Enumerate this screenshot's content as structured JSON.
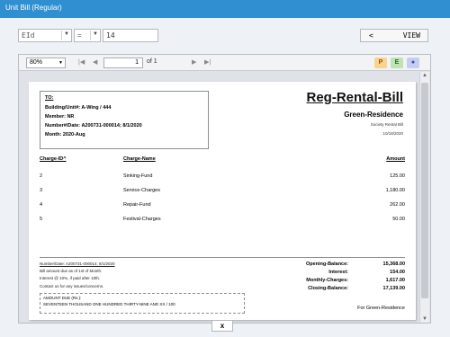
{
  "window": {
    "title": "Unit Bill (Regular)"
  },
  "filter": {
    "field_value": "EId",
    "operator_value": "=",
    "search_value": "14",
    "view_button_left": "<",
    "view_button_label": "VIEW"
  },
  "report_toolbar": {
    "zoom": "80%",
    "first": "|◀",
    "prev": "◀",
    "page": "1",
    "of_pages": "of 1",
    "next": "▶",
    "last": "▶|",
    "export_pdf": "P",
    "export_excel": "E",
    "export_other": "●"
  },
  "bill": {
    "to_label": "TO:",
    "building_unit": "Building/Unit#: A-Wing / 444",
    "member": "Member: NR",
    "number_date": "Number#/Date: A200731-000014; 8/1/2020",
    "month": "Month: 2020-Aug",
    "title": "Reg-Rental-Bill",
    "org": "Green-Residence",
    "subtitle": "Society Rental Bill",
    "date": "10/18/2020",
    "columns": {
      "id": "Charge-ID^",
      "name": "Charge-Name",
      "amount": "Amount"
    },
    "rows": [
      {
        "id": "2",
        "name": "Sinking-Fund",
        "amount": "125.00"
      },
      {
        "id": "3",
        "name": "Service-Charges",
        "amount": "1,180.00"
      },
      {
        "id": "4",
        "name": "Repair-Fund",
        "amount": "262.00"
      },
      {
        "id": "5",
        "name": "Festival-Charges",
        "amount": "50.00"
      }
    ],
    "footer_number": "Number/Date: A200731-000014; 8/1/2020",
    "note1": "Bill amount due as of 1st of Month.",
    "note2": "Interest @ 10%, if paid after 10th.",
    "note3": "Contact us for any issues/concerns.",
    "amount_due_label": "AMOUNT DUE (Rs.):",
    "amount_due_words": "SEVENTEEN THOUSAND ONE HUNDRED THIRTY-NINE AND XX / 100",
    "summary": [
      {
        "label": "Opening-Balance:",
        "value": "15,368.00"
      },
      {
        "label": "Interest:",
        "value": "154.00"
      },
      {
        "label": "Monthly-Charges:",
        "value": "1,617.00"
      },
      {
        "label": "Closing-Balance:",
        "value": "17,139.00"
      }
    ],
    "for_org": "For Green-Residence"
  },
  "close_label": "x",
  "colors": {
    "titlebar": "#2f8fd1",
    "pdf": "#f7d58a",
    "excel": "#bfe3b4",
    "other": "#c5cdf2"
  }
}
